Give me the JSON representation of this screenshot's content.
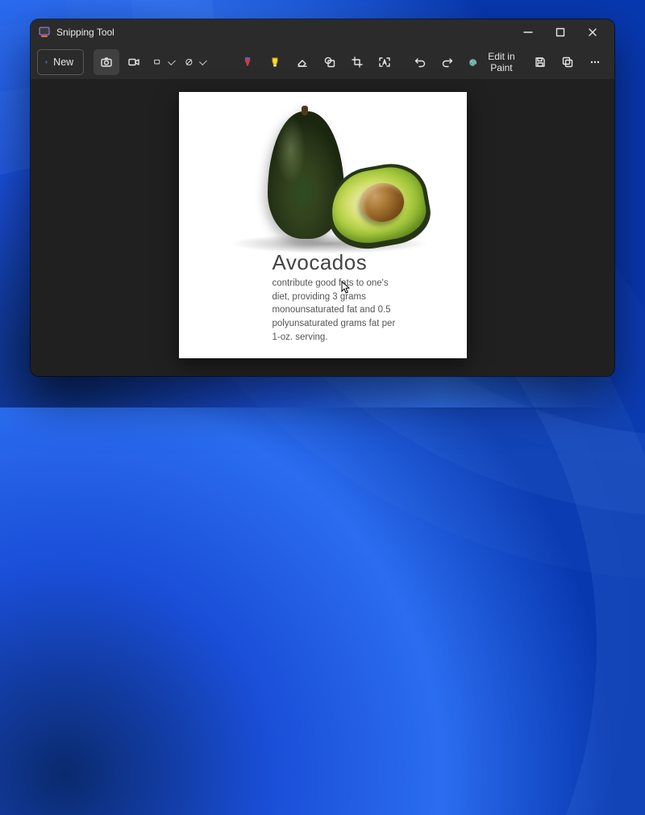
{
  "window": {
    "title": "Snipping Tool"
  },
  "toolbar": {
    "new_label": "New",
    "edit_in_paint_label": "Edit in Paint"
  },
  "content": {
    "heading": "Avocados",
    "body": "contribute good fats to one's diet, providing 3 grams monounsaturated fat and 0.5 polyunsaturated grams fat per 1-oz. serving."
  }
}
